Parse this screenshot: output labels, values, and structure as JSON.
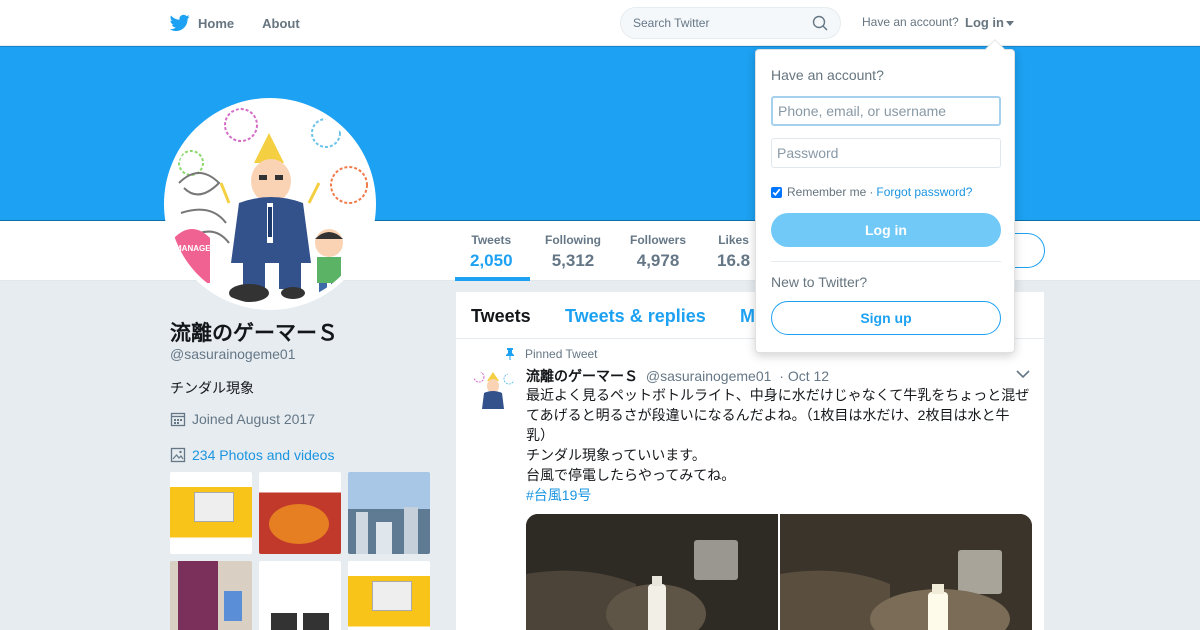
{
  "nav": {
    "home_label": "Home",
    "about_label": "About",
    "search_placeholder": "Search Twitter",
    "have_account": "Have an account?",
    "login_label": "Log in"
  },
  "profile": {
    "name": "流離のゲーマーＳ",
    "handle": "@sasurainogeme01",
    "bio": "チンダル現象",
    "joined": "Joined August 2017",
    "photos_link": "234 Photos and videos",
    "stats": [
      {
        "label": "Tweets",
        "value": "2,050"
      },
      {
        "label": "Following",
        "value": "5,312"
      },
      {
        "label": "Followers",
        "value": "4,978"
      },
      {
        "label": "Likes",
        "value": "16.8"
      }
    ]
  },
  "timeline": {
    "tabs": [
      "Tweets",
      "Tweets & replies",
      "M"
    ],
    "tweet": {
      "pinned_label": "Pinned Tweet",
      "author_name": "流離のゲーマーＳ",
      "author_handle": "@sasurainogeme01",
      "date": "· Oct 12",
      "lines": [
        "最近よく見るペットボトルライト、中身に水だけじゃなくて牛乳をちょっと混ぜ",
        "てあげると明るさが段違いになるんだよね。（1枚目は水だけ、2枚目は水と牛",
        "乳）",
        "チンダル現象っていいます。",
        "台風で停電したらやってみてね。"
      ],
      "hashtag": "#台風19号"
    }
  },
  "login_dropdown": {
    "title": "Have an account?",
    "username_placeholder": "Phone, email, or username",
    "password_placeholder": "Password",
    "remember_label": "Remember me",
    "separator": "·",
    "forgot_label": "Forgot password?",
    "login_button": "Log in",
    "new_label": "New to Twitter?",
    "signup_button": "Sign up"
  },
  "colors": {
    "brand": "#1da1f2",
    "link": "#1b95e0",
    "muted": "#657786"
  }
}
